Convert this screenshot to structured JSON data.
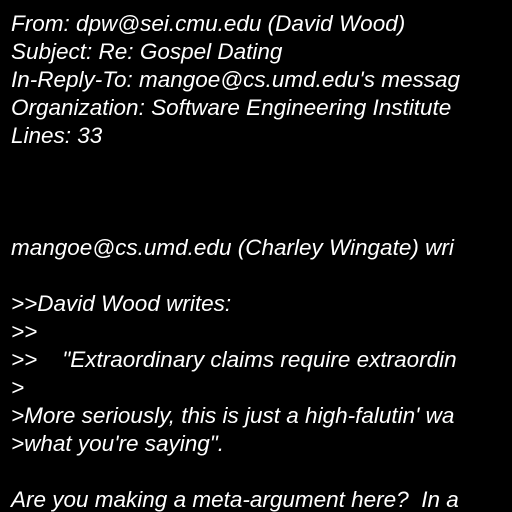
{
  "colors": {
    "background": "#000000",
    "text": "#ffffff"
  },
  "header": {
    "from": "From: dpw@sei.cmu.edu (David Wood)",
    "subject": "Subject: Re: Gospel Dating",
    "in_reply_to": "In-Reply-To: mangoe@cs.umd.edu's messag",
    "organization": "Organization: Software Engineering Institute",
    "lines": "Lines: 33"
  },
  "body": {
    "attribution": "mangoe@cs.umd.edu (Charley Wingate) wri",
    "quoted_author": ">>David Wood writes:",
    "quote_blank_1": ">>",
    "quote_claim": ">>    \"Extraordinary claims require extraordin",
    "quote_blank_2": ">",
    "quote_reply_1": ">More seriously, this is just a high-falutin' wa",
    "quote_reply_2": ">what you're saying\".",
    "reply": "Are you making a meta-argument here?  In a"
  }
}
